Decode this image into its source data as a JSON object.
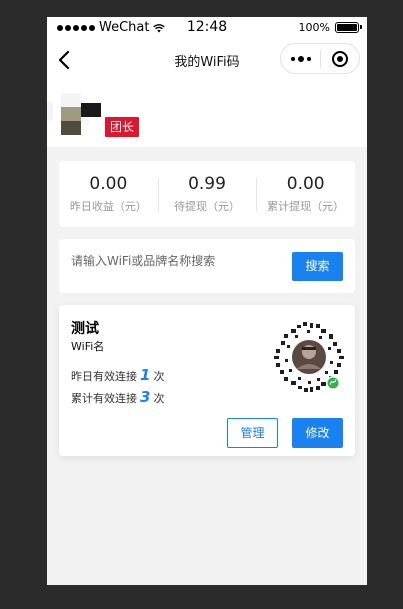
{
  "status_bar": {
    "carrier": "WeChat",
    "time": "12:48",
    "battery": "100%"
  },
  "nav": {
    "title": "我的WiFi码"
  },
  "profile": {
    "badge": "团长"
  },
  "stats": [
    {
      "value": "0.00",
      "label": "昨日收益（元）"
    },
    {
      "value": "0.99",
      "label": "待提现（元）"
    },
    {
      "value": "0.00",
      "label": "累计提现（元）"
    }
  ],
  "search": {
    "placeholder": "请输入WiFi或品牌名称搜索",
    "button": "搜索"
  },
  "wifi_card": {
    "name": "测试",
    "subtitle": "WiFi名",
    "yesterday_label": "昨日有效连接",
    "yesterday_count": "1",
    "total_label": "累计有效连接",
    "total_count": "3",
    "unit": "次",
    "manage_button": "管理",
    "edit_button": "修改"
  },
  "colors": {
    "accent": "#1a82f0",
    "badge": "#e0162d"
  }
}
